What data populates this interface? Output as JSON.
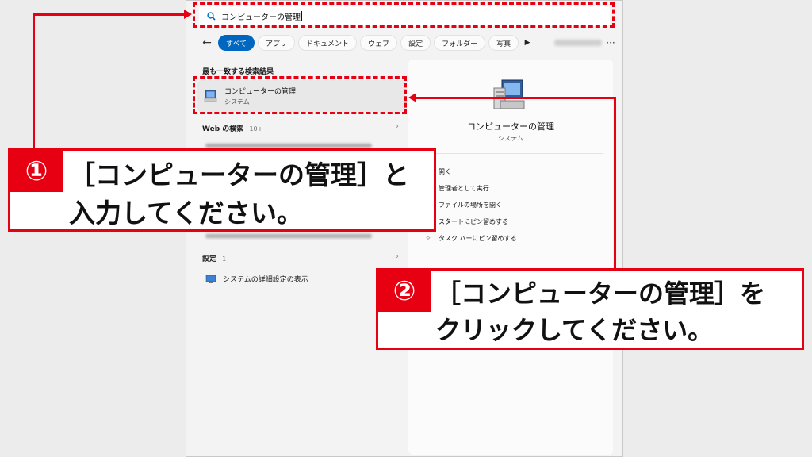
{
  "search": {
    "query": "コンピューターの管理"
  },
  "filters": {
    "tabs": [
      "すべて",
      "アプリ",
      "ドキュメント",
      "ウェブ",
      "設定",
      "フォルダー",
      "写真"
    ],
    "active": "すべて",
    "more_icon": "ellipsis-icon"
  },
  "best_match": {
    "header": "最も一致する検索結果",
    "title": "コンピューターの管理",
    "subtitle": "システム"
  },
  "web": {
    "header": "Web の検索",
    "count": "10+"
  },
  "settings": {
    "header": "設定",
    "count": "1",
    "item": "システムの詳細設定の表示"
  },
  "detail": {
    "title": "コンピューターの管理",
    "subtitle": "システム",
    "actions": [
      {
        "icon": "open-icon",
        "label": "開く"
      },
      {
        "icon": "shield-icon",
        "label": "管理者として実行"
      },
      {
        "icon": "folder-icon",
        "label": "ファイルの場所を開く"
      },
      {
        "icon": "pin-icon",
        "label": "スタートにピン留めする"
      },
      {
        "icon": "pin-icon",
        "label": "タスク バーにピン留めする"
      }
    ]
  },
  "callouts": {
    "step1": {
      "number": "①",
      "line1": "［コンピューターの管理］と",
      "line2": "入力してください。"
    },
    "step2": {
      "number": "②",
      "line1": "［コンピューターの管理］を",
      "line2": "クリックしてください。"
    }
  },
  "colors": {
    "accent": "#e60012",
    "tab_active": "#0067c0"
  }
}
